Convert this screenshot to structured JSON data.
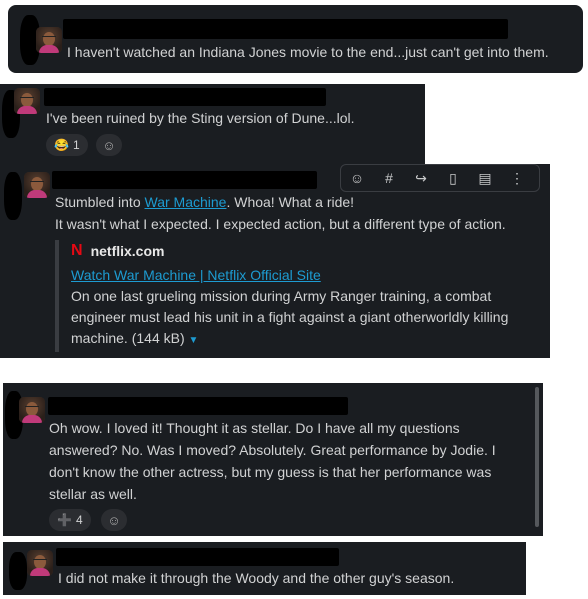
{
  "messages": [
    {
      "text": "I haven't watched an Indiana Jones movie to the end...just can't get into them."
    },
    {
      "text": "I've been ruined by the Sting version of Dune...lol.",
      "reactions": [
        {
          "emoji": "😂",
          "count": "1"
        }
      ]
    },
    {
      "text_before": "Stumbled into ",
      "link_text": "War Machine",
      "text_after": ". Whoa! What a ride!",
      "line2": "It wasn't what I expected. I expected action, but a different type of action.",
      "preview": {
        "logo": "N",
        "site": "netflix.com",
        "title": "Watch War Machine | Netflix Official Site",
        "description": "On one last grueling mission during Army Ranger training, a combat engineer must lead his unit in a fight against a giant otherworldly killing machine.",
        "size": "(144 kB)"
      }
    },
    {
      "text": "Oh wow. I loved it! Thought it as stellar. Do I have all my questions answered? No. Was I moved? Absolutely. Great performance by Jodie. I don't know the other actress, but my guess is that her performance was stellar as well.",
      "reactions": [
        {
          "emoji": "➕",
          "count": "4"
        }
      ]
    },
    {
      "text": "I did not make it through the Woody and the other guy's season."
    }
  ],
  "toolbar_icons": [
    "add-reaction-icon",
    "hashtag-icon",
    "share-icon",
    "bookmark-icon",
    "reply-icon",
    "more-icon"
  ]
}
